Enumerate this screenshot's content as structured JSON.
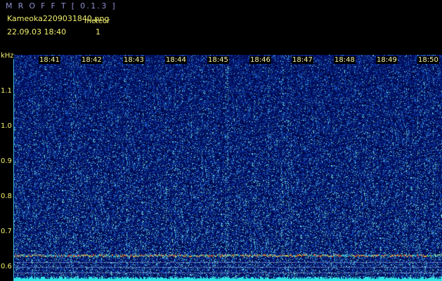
{
  "header": {
    "app_title": "M R O F F T [ 0.1.3 ]",
    "file_name": "Kameoka2209031840.png",
    "datetime": "22.09.03  18:40",
    "meteor_label": "meteor",
    "meteor_count": "1"
  },
  "axis": {
    "freq_unit": "kHz",
    "time_ticks": [
      "18:41",
      "18:42",
      "18:43",
      "18:44",
      "18:45",
      "18:46",
      "18:47",
      "18:48",
      "18:49",
      "18:50"
    ],
    "freq_ticks": [
      "1.1",
      "1.0",
      "0.9",
      "0.8",
      "0.7",
      "0.6"
    ]
  },
  "colors": {
    "background": "#000000",
    "plot_background": "#000a4a",
    "title_color": "#8e8ecf",
    "label_color": "#f0ef6e",
    "axis_color": "#3fb8e0",
    "noise_floor_color": "#2ee6e6",
    "carrier_color": "#e85a2a"
  }
}
